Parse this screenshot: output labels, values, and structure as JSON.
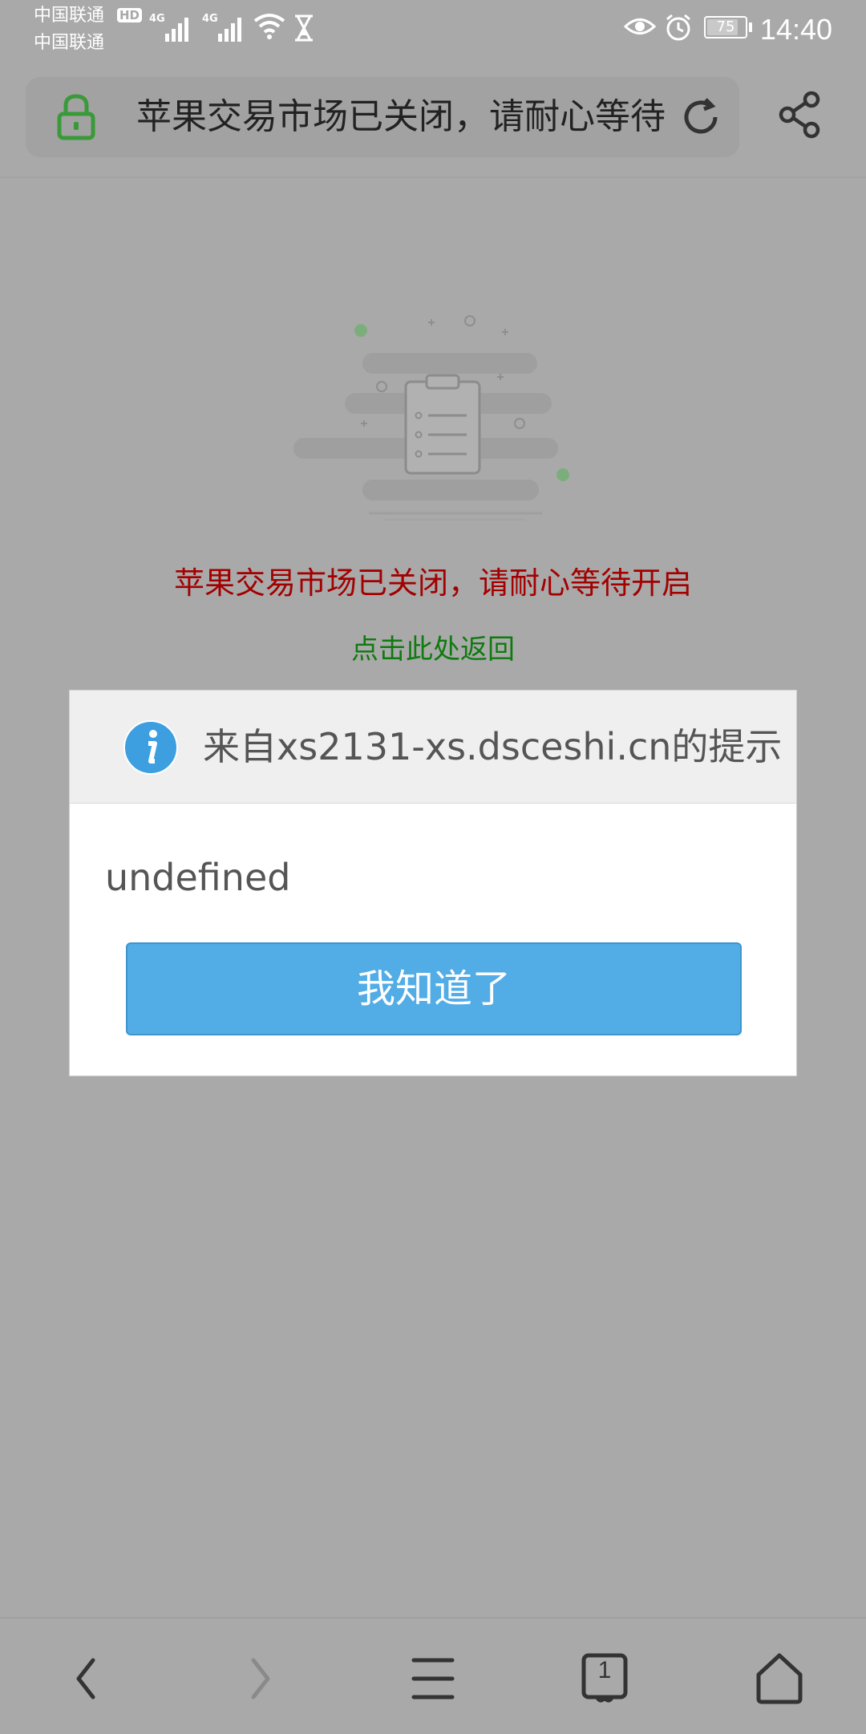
{
  "status_bar": {
    "carrier_1": "中国联通",
    "carrier_2": "中国联通",
    "hd_badge": "HD",
    "network_1": "4G",
    "network_2": "4G",
    "battery": "75",
    "time": "14:40"
  },
  "address_bar": {
    "title": "苹果交易市场已关闭，请耐心等待开启"
  },
  "page": {
    "closed_message": "苹果交易市场已关闭，请耐心等待开启",
    "back_link": "点击此处返回"
  },
  "dialog": {
    "title": "来自xs2131-xs.dsceshi.cn的提示",
    "message": "undefined",
    "ok_label": "我知道了"
  },
  "bottom_nav": {
    "tab_count": "1"
  },
  "colors": {
    "overlay": "#a9a9a9",
    "error_text": "#a30000",
    "link_text": "#0f7a0f",
    "primary_button": "#52ade6",
    "lock_green": "#3a9a3a"
  }
}
